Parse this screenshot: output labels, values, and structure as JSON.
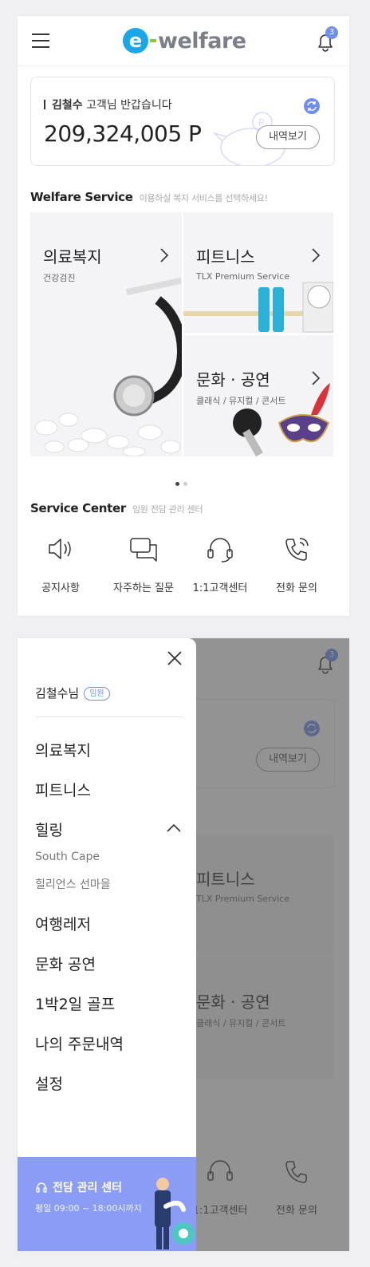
{
  "header": {
    "logo_text": "welfare",
    "logo_letter": "e",
    "notification_count": "3"
  },
  "points": {
    "user_name": "김철수",
    "greeting_suffix": " 고객님 반갑습니다",
    "amount": "209,324,005 P",
    "history_button": "내역보기"
  },
  "welfare_service": {
    "title": "Welfare Service",
    "subtitle": "이용하실 복지 서비스를 선택하세요!",
    "tiles": [
      {
        "title": "의료복지",
        "subtitle": "건강검진"
      },
      {
        "title": "피트니스",
        "subtitle": "TLX Premium Service"
      },
      {
        "title": "문화 · 공연",
        "subtitle": "클래식 / 뮤지컬 / 콘서트"
      }
    ],
    "carousel_pages": 2,
    "carousel_active": 1
  },
  "service_center": {
    "title": "Service Center",
    "subtitle": "임원 전담 관리 센터",
    "items": [
      {
        "label": "공지사항",
        "icon": "speaker-icon"
      },
      {
        "label": "자주하는 질문",
        "icon": "chat-bubbles-icon"
      },
      {
        "label": "1:1고객센터",
        "icon": "headset-icon"
      },
      {
        "label": "전화 문의",
        "icon": "phone-icon"
      }
    ]
  },
  "drawer": {
    "user_name": "김철수님",
    "role_badge": "임원",
    "menu": [
      {
        "label": "의료복지"
      },
      {
        "label": "피트니스"
      },
      {
        "label": "힐링",
        "expanded": true,
        "children": [
          "South Cape",
          "힐리언스 선마을"
        ]
      },
      {
        "label": "여행레저"
      },
      {
        "label": "문화 공연"
      },
      {
        "label": "1박2일 골프"
      },
      {
        "label": "나의 주문내역"
      },
      {
        "label": "설정"
      }
    ],
    "footer": {
      "title": "전담 관리 센터",
      "hours": "평일 09:00 ~ 18:00시까지"
    }
  },
  "colors": {
    "accent": "#6e8ef0",
    "logo_blue": "#1aa6e8",
    "logo_green": "#8cc63f",
    "footer_bg": "#8a9cf4"
  }
}
